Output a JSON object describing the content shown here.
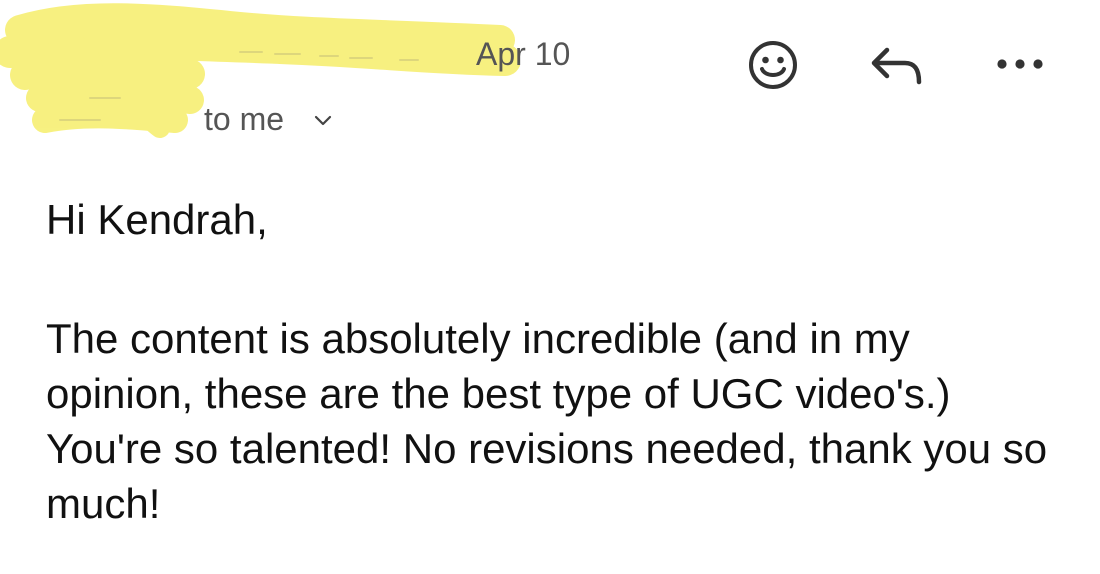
{
  "header": {
    "date": "Apr 10",
    "recipient_label": "to me",
    "icons": {
      "expand": "chevron-down-icon",
      "react": "smiley-face-icon",
      "reply": "reply-arrow-icon",
      "more": "more-dots-icon"
    },
    "redaction_color": "#f7f07a"
  },
  "message": {
    "greeting": "Hi Kendrah,",
    "body": "The content is absolutely incredible (and in my opinion, these are the best type of UGC video's.) You're so talented! No revisions needed, thank you so much!"
  }
}
